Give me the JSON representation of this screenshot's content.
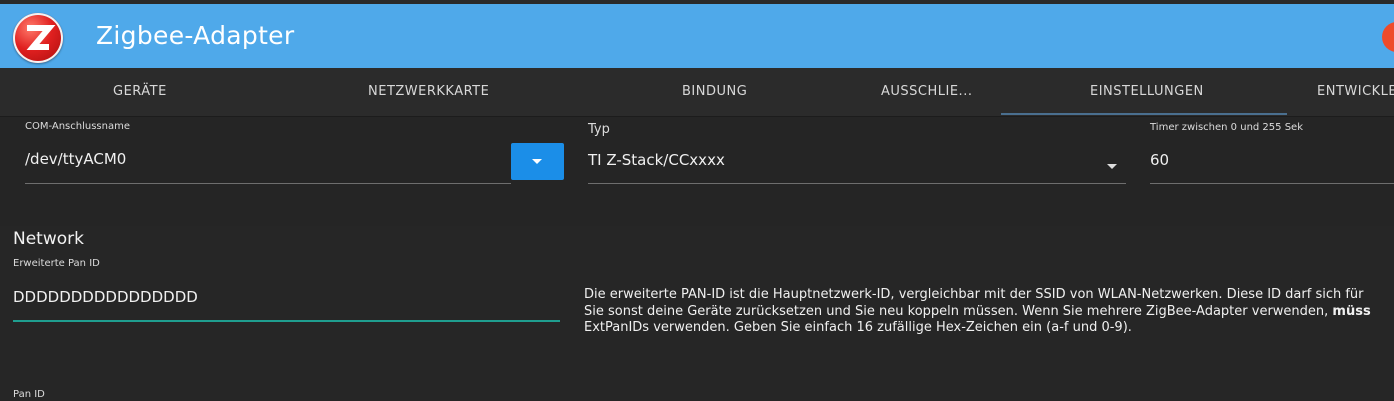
{
  "header": {
    "title": "Zigbee-Adapter",
    "color": "#4fa9ea"
  },
  "tabs": [
    {
      "label": "GERÄTE"
    },
    {
      "label": "NETZWERKKARTE"
    },
    {
      "label": "BINDUNG"
    },
    {
      "label": "AUSSCHLIE..."
    },
    {
      "label": "EINSTELLUNGEN",
      "active": true
    },
    {
      "label": "ENTWICKLE"
    }
  ],
  "settings": {
    "com_port": {
      "label": "COM-Anschlussname",
      "value": "/dev/ttyACM0"
    },
    "type": {
      "label": "Typ",
      "value": "TI Z-Stack/CCxxxx"
    },
    "timer": {
      "label": "Timer zwischen 0 und 255 Sek",
      "value": "60"
    }
  },
  "network": {
    "title": "Network",
    "ext_pan_id": {
      "label": "Erweiterte Pan ID",
      "value": "DDDDDDDDDDDDDDDD"
    },
    "help_line1": "Die erweiterte PAN-ID ist die Hauptnetzwerk-ID, vergleichbar mit der SSID von WLAN-Netzwerken. Diese ID darf sich für",
    "help_line2_pre": "Sie sonst deine Geräte zurücksetzen und Sie neu koppeln müssen. Wenn Sie mehrere ZigBee-Adapter verwenden, ",
    "help_line2_bold": "müss",
    "help_line3": "ExtPanIDs verwenden. Geben Sie einfach 16 zufällige Hex-Zeichen ein (a-f und 0-9).",
    "pan_id": {
      "label": "Pan ID"
    }
  }
}
